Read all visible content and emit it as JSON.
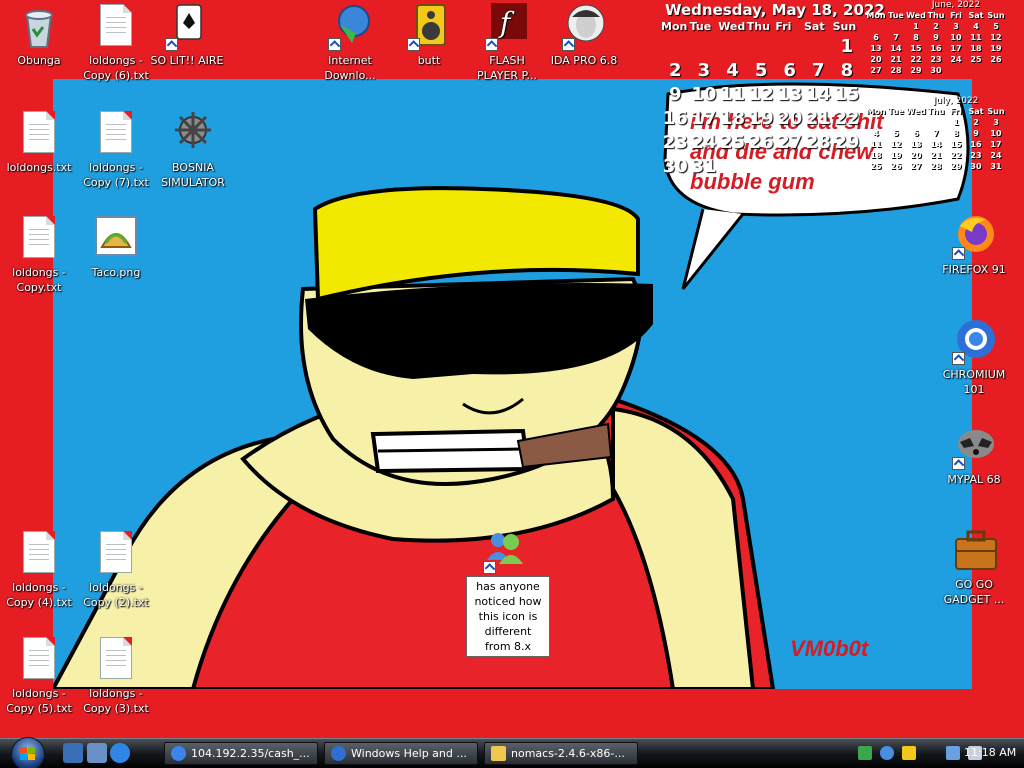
{
  "desktop_icons": {
    "recycle": "Obunga",
    "solit": "SO LIT!! AIRE",
    "idm": "Internet Downlo...",
    "butt": "butt",
    "flash": "FLASH PLAYER P...",
    "ida": "IDA PRO 6.8",
    "loldongs": "loldongs.txt",
    "copy7": "loldongs - Copy (7).txt",
    "copy6": "loldongs - Copy (6).txt",
    "bosnia": "BOSNIA SIMULATOR",
    "copy": "loldongs - Copy.txt",
    "taco": "Taco.png",
    "copy4": "loldongs - Copy (4).txt",
    "copy2": "loldongs - Copy (2).txt",
    "copy5": "loldongs - Copy (5).txt",
    "copy3": "loldongs - Copy (3).txt",
    "firefox": "FIREFOX 91",
    "chromium": "CHROMIUM 101",
    "mypal": "MYPAL 68",
    "gadget": "GO GO GADGET ..."
  },
  "calendar": {
    "date_line": "Wednesday, May 18, 2022",
    "dows": [
      "Mon",
      "Tue",
      "Wed",
      "Thu",
      "Fri",
      "Sat",
      "Sun"
    ],
    "may_days": [
      "",
      "",
      "",
      "",
      "",
      "",
      "1",
      "2",
      "3",
      "4",
      "5",
      "6",
      "7",
      "8",
      "9",
      "10",
      "11",
      "12",
      "13",
      "14",
      "15",
      "16",
      "17",
      "18",
      "19",
      "20",
      "21",
      "22",
      "23",
      "24",
      "25",
      "26",
      "27",
      "28",
      "29",
      "30",
      "31"
    ],
    "june_title": "June, 2022",
    "june_days": [
      "",
      "",
      "1",
      "2",
      "3",
      "4",
      "5",
      "6",
      "7",
      "8",
      "9",
      "10",
      "11",
      "12",
      "13",
      "14",
      "15",
      "16",
      "17",
      "18",
      "19",
      "20",
      "21",
      "22",
      "23",
      "24",
      "25",
      "26",
      "27",
      "28",
      "29",
      "30"
    ],
    "july_title": "July, 2022",
    "july_days": [
      "",
      "",
      "",
      "",
      "1",
      "2",
      "3",
      "4",
      "5",
      "6",
      "7",
      "8",
      "9",
      "10",
      "11",
      "12",
      "13",
      "14",
      "15",
      "16",
      "17",
      "18",
      "19",
      "20",
      "21",
      "22",
      "23",
      "24",
      "25",
      "26",
      "27",
      "28",
      "29",
      "30",
      "31"
    ]
  },
  "wallpaper": {
    "speech_line1": "i'm here to eat shit",
    "speech_line2": "and die and chew",
    "speech_line3": "bubble gum",
    "signature": "VM0b0t"
  },
  "tooltip": "has anyone noticed how this icon is different from 8.x",
  "taskbar": {
    "tasks": [
      {
        "label": "104.192.2.35/cash_..."
      },
      {
        "label": "Windows Help and ..."
      },
      {
        "label": "nomacs-2.4.6-x86-..."
      }
    ],
    "clock": "11:18 AM"
  },
  "colors": {
    "desktop": "#e61e24",
    "wall": "#1f9ee0",
    "speech_red": "#d41c24"
  }
}
